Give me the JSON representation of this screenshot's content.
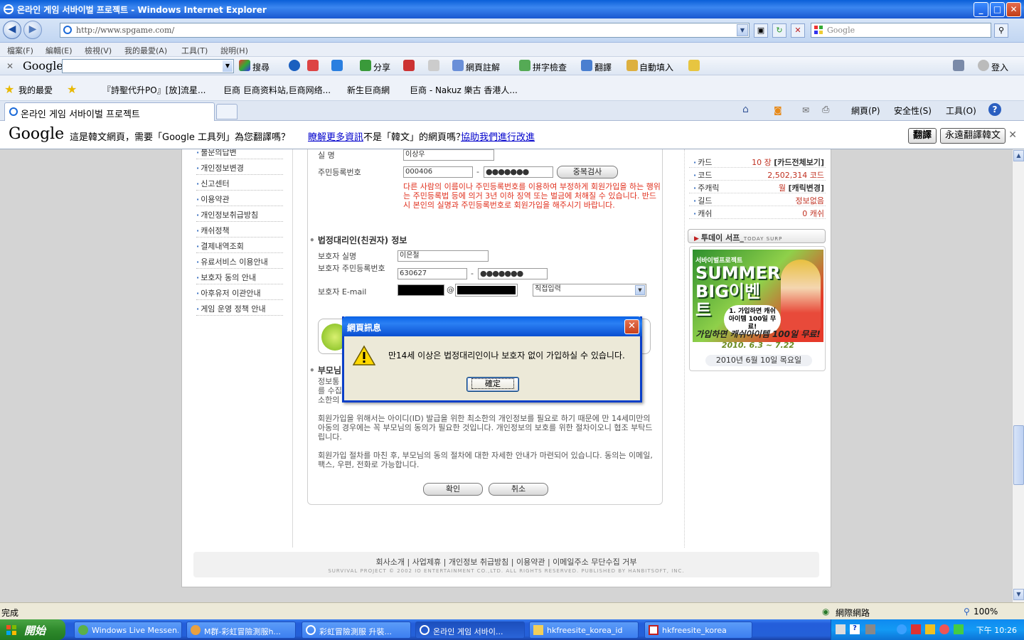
{
  "window": {
    "title": "온라인 게임 서바이벌 프로젝트 - Windows Internet Explorer",
    "min": "_",
    "max": "□",
    "close": "✕"
  },
  "address": {
    "url": "http://www.spgame.com/",
    "search_placeholder": "Google"
  },
  "menu": [
    "檔案(F)",
    "編輯(E)",
    "檢視(V)",
    "我的最愛(A)",
    "工具(T)",
    "說明(H)"
  ],
  "gtoolbar": {
    "logo": "Google",
    "items": [
      "搜尋",
      "分享",
      "網頁註解",
      "拼字檢查",
      "翻譯",
      "自動填入"
    ],
    "signin": "登入"
  },
  "favorites": {
    "label": "我的最愛",
    "links": [
      "『詩聖代升PO』[放]流星...",
      "巨商 巨商资料站,巨商网络...",
      "新生巨商網",
      "巨商 - Nakuz 樂古 香港人..."
    ]
  },
  "tab": {
    "title": "온라인 게임 서바이벌 프로젝트"
  },
  "cmdbar": {
    "page": "網頁(P)",
    "safety": "安全性(S)",
    "tools": "工具(O)"
  },
  "translate": {
    "logo": "Google",
    "message": "這是韓文網頁，需要「Google 工具列」為您翻譯嗎？",
    "learn_more": "瞭解更多資訊",
    "not_korean": "不是「韓文」的網頁嗎？",
    "help_improve": "協助我們進行改進",
    "translate_btn": "翻譯",
    "always_btn": "永遠翻譯韓文"
  },
  "leftnav": {
    "partial_top": "불문의답변",
    "items": [
      "개인정보변경",
      "신고센터",
      "이용약관",
      "개인정보취급방침",
      "캐쉬정책",
      "결제내역조회",
      "유료서비스 이용안내",
      "보호자 동의 안내",
      "아후유저 이관안내",
      "게임 운영 정책 안내"
    ]
  },
  "form": {
    "name_label": "실 명",
    "name_value": "이상우",
    "ssn_label": "주민등록번호",
    "ssn_front": "000406",
    "ssn_dash": "-",
    "ssn_back": "●●●●●●●",
    "dup_check": "중복검사",
    "warning": "다른 사람의 이름이나 주민등록번호를 이용하여 부정하게 회원가입을 하는 행위는 주민등록법 등에 의거 3년 이하 징역 또는 벌금에 처해질 수 있습니다. 반드시 본인의 실명과 주민등록번호로 회원가입을 해주시기 바랍니다.",
    "guardian_heading": "법정대리인(친권자) 정보",
    "g_name_label": "보호자 실명",
    "g_name_value": "이은철",
    "g_ssn_label": "보호자 주민등록번호",
    "g_ssn_front": "630627",
    "g_ssn_back": "●●●●●●●",
    "g_email_label": "보호자 E-mail",
    "at": "@",
    "email_select": "직접입력",
    "parent_heading": "부모님",
    "para1_a": "정보통",
    "para1_b": "를 수집",
    "para1_c": "소한의",
    "para2": "회원가입을 위해서는 아이디(ID) 발급을 위한 최소한의 개인정보를 필요로 하기 때문에 만 14세미만의 아동의 경우에는 꼭 부모님의 동의가 필요한 것입니다. 개인정보의 보호를 위한 절차이오니 협조 부탁드립니다.",
    "para3": "회원가입 절차를 마친 후, 부모님의 동의 절차에 대한 자세한 안내가 마련되어 있습니다. 동의는 이메일, 팩스, 우편, 전화로 가능합니다.",
    "confirm": "확인",
    "cancel": "취소"
  },
  "stats": [
    {
      "k": "카드",
      "v": "10 장",
      "extra": "[카드전체보기]"
    },
    {
      "k": "코드",
      "v": "2,502,314 코드",
      "extra": ""
    },
    {
      "k": "주캐릭",
      "v": "월",
      "extra": "[캐릭변경]"
    },
    {
      "k": "길드",
      "v": "정보없음",
      "extra": ""
    },
    {
      "k": "캐쉬",
      "v": "0 캐쉬",
      "extra": ""
    }
  ],
  "today": {
    "title": "투데이 서프_",
    "sub": "TODAY SURP"
  },
  "banner": {
    "small": "서바이벌프로젝트",
    "big": "SUMMER BIG이벤트",
    "bubble": "1. 가입하면 캐쉬아이템 100일 무료!",
    "line1": "가입하면 캐쉬아이템 100일 무료!",
    "line2": "2010. 6.3 ~ 7.22",
    "date": "2010년 6월 10일 목요일"
  },
  "footer": {
    "links": "회사소개 | 사업제휴 | 개인정보 취급방침 | 이용약관 | 이메일주소 무단수집 거부",
    "copy": "SURVIVAL PROJECT © 2002 IO ENTERTAINMENT CO.,LTD. ALL RIGHTS RESERVED. PUBLISHED BY HANBITSOFT, INC."
  },
  "dialog": {
    "title": "網頁訊息",
    "message": "만14세 이상은 법정대리인이나 보호자 없이 가입하실 수 있습니다.",
    "ok": "確定"
  },
  "status": {
    "left": "完成",
    "zone": "網際網路",
    "zoom": "100%"
  },
  "taskbar": {
    "start": "開始",
    "items": [
      "Windows Live Messen...",
      "M群-彩虹冒險測服h...",
      "彩虹冒險測服 升裝...",
      "온라인 게임 서바이...",
      "hkfreesite_korea_id",
      "hkfreesite_korea"
    ],
    "clock": "下午 10:26"
  },
  "colors": {
    "accent": "#0a5fd8",
    "warning_text": "#e0301e",
    "link": "#0000cc"
  }
}
